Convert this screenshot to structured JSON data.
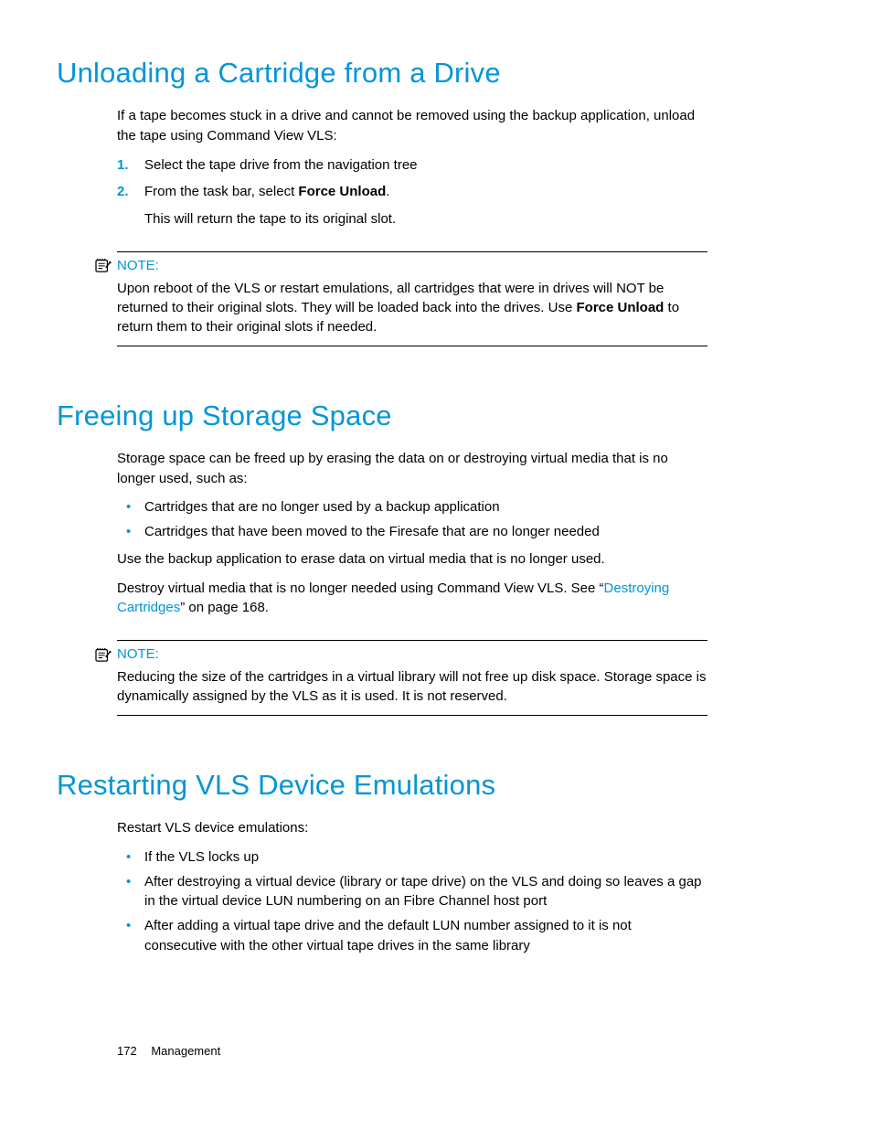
{
  "s1": {
    "title": "Unloading a Cartridge from a Drive",
    "intro": "If a tape becomes stuck in a drive and cannot be removed using the backup application, unload the tape using Command View VLS:",
    "step1_marker": "1.",
    "step1": "Select the tape drive from the navigation tree",
    "step2_marker": "2.",
    "step2_pre": "From the task bar, select ",
    "step2_bold": "Force Unload",
    "step2_post": ".",
    "step2_sub": "This will return the tape to its original slot.",
    "note_label": "NOTE:",
    "note_pre": "Upon reboot of the VLS or restart emulations, all cartridges that were in drives will NOT be returned to their original slots. They will be loaded back into the drives. Use ",
    "note_bold": "Force Unload",
    "note_post": " to return them to their original slots if needed."
  },
  "s2": {
    "title": "Freeing up Storage Space",
    "intro": "Storage space can be freed up by erasing the data on or destroying virtual media that is no longer used, such as:",
    "b1": "Cartridges that are no longer used by a backup application",
    "b2": "Cartridges that have been moved to the Firesafe that are no longer needed",
    "p2": "Use the backup application to erase data on virtual media that is no longer used.",
    "p3_pre": "Destroy virtual media that is no longer needed using Command View VLS. See “",
    "p3_link": "Destroying Cartridges",
    "p3_post": "” on page 168.",
    "note_label": "NOTE:",
    "note_body": "Reducing the size of the cartridges in a virtual library will not free up disk space. Storage space is dynamically assigned by the VLS as it is used. It is not reserved."
  },
  "s3": {
    "title": "Restarting VLS Device Emulations",
    "intro": "Restart VLS device emulations:",
    "b1": "If the VLS locks up",
    "b2": "After destroying a virtual device (library or tape drive) on the VLS and doing so leaves a gap in the virtual device LUN numbering on an Fibre Channel host port",
    "b3": "After adding a virtual tape drive and the default LUN number assigned to it is not consecutive with the other virtual tape drives in the same library"
  },
  "footer": {
    "page": "172",
    "section": "Management"
  }
}
